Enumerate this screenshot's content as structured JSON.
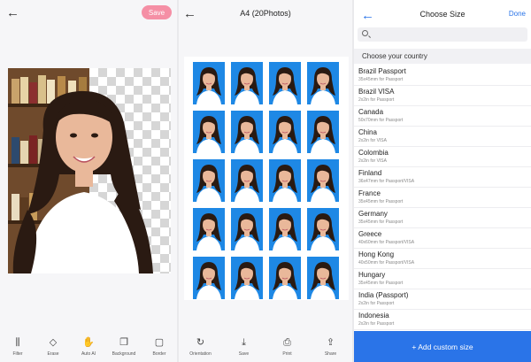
{
  "editor": {
    "save_label": "Save",
    "tools": [
      {
        "label": "Filter",
        "icon": "sliders-icon"
      },
      {
        "label": "Erase",
        "icon": "eraser-icon"
      },
      {
        "label": "Auto AI",
        "icon": "hand-icon"
      },
      {
        "label": "Background",
        "icon": "layers-icon"
      },
      {
        "label": "Border",
        "icon": "border-icon"
      }
    ]
  },
  "sheet": {
    "title": "A4 (20Photos)",
    "rows": 5,
    "cols": 4,
    "tile_color": "#1e88e5",
    "tools": [
      {
        "label": "Orientation",
        "icon": "rotate-icon"
      },
      {
        "label": "Save",
        "icon": "download-icon"
      },
      {
        "label": "Print",
        "icon": "printer-icon"
      },
      {
        "label": "Share",
        "icon": "share-icon"
      }
    ]
  },
  "size_picker": {
    "title": "Choose Size",
    "done_label": "Done",
    "section_label": "Choose your country",
    "countries": [
      {
        "name": "Brazil Passport",
        "size": "35x45mm for Passport"
      },
      {
        "name": "Brazil VISA",
        "size": "2x2in for Passport"
      },
      {
        "name": "Canada",
        "size": "50x70mm for Passport"
      },
      {
        "name": "China",
        "size": "2x2in for VISA"
      },
      {
        "name": "Colombia",
        "size": "2x2in for VISA"
      },
      {
        "name": "Finland",
        "size": "36x47mm for Passport/VISA"
      },
      {
        "name": "France",
        "size": "35x45mm for Passport"
      },
      {
        "name": "Germany",
        "size": "35x45mm for Passport"
      },
      {
        "name": "Greece",
        "size": "40x60mm for Passport/VISA"
      },
      {
        "name": "Hong Kong",
        "size": "40x50mm for Passport/VISA"
      },
      {
        "name": "Hungary",
        "size": "35x45mm for Passport"
      },
      {
        "name": "India (Passport)",
        "size": "2x2in for Passport"
      },
      {
        "name": "Indonesia",
        "size": "2x2in for Passport"
      }
    ],
    "add_label": "+ Add custom size"
  },
  "colors": {
    "accent": "#2a74e8",
    "save_pink": "#f58fa5"
  }
}
